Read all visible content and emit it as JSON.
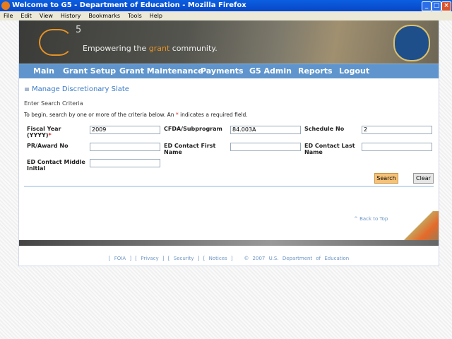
{
  "window": {
    "title": "Welcome to G5 - Department of Education - Mozilla Firefox"
  },
  "menu": [
    "File",
    "Edit",
    "View",
    "History",
    "Bookmarks",
    "Tools",
    "Help"
  ],
  "banner": {
    "logo": "G",
    "logo_sup": "5",
    "tagline_pre": "Empowering the ",
    "tagline_accent": "grant",
    "tagline_post": " community."
  },
  "nav": [
    "Main",
    "Grant Setup",
    "Grant Maintenance",
    "Payments",
    "G5 Admin",
    "Reports",
    "Logout"
  ],
  "page_title": "Manage Discretionary Slate",
  "section_title": "Enter Search Criteria",
  "intro_pre": "To begin, search by one or more of the criteria below. An ",
  "intro_star": "*",
  "intro_post": " indicates a required field.",
  "fields": {
    "fiscal_year": {
      "label": "Fiscal Year (YYYY)",
      "value": "2009",
      "required": "*"
    },
    "cfda": {
      "label": "CFDA/Subprogram",
      "value": "84.003A"
    },
    "schedule": {
      "label": "Schedule No",
      "value": "2"
    },
    "pr_award": {
      "label": "PR/Award No",
      "value": ""
    },
    "first": {
      "label": "ED Contact First Name",
      "value": ""
    },
    "last": {
      "label": "ED Contact Last Name",
      "value": ""
    },
    "middle": {
      "label": "ED Contact Middle Initial",
      "value": ""
    }
  },
  "buttons": {
    "search": "Search",
    "clear": "Clear"
  },
  "back_to_top": "^ Back to Top",
  "footer": {
    "foia": "FOIA",
    "privacy": "Privacy",
    "security": "Security",
    "notices": "Notices",
    "copyright": "© 2007 U.S. Department of Education"
  },
  "colors": {
    "nav": "#5f95cc",
    "accent": "#e59324",
    "link": "#3a7bc8"
  }
}
